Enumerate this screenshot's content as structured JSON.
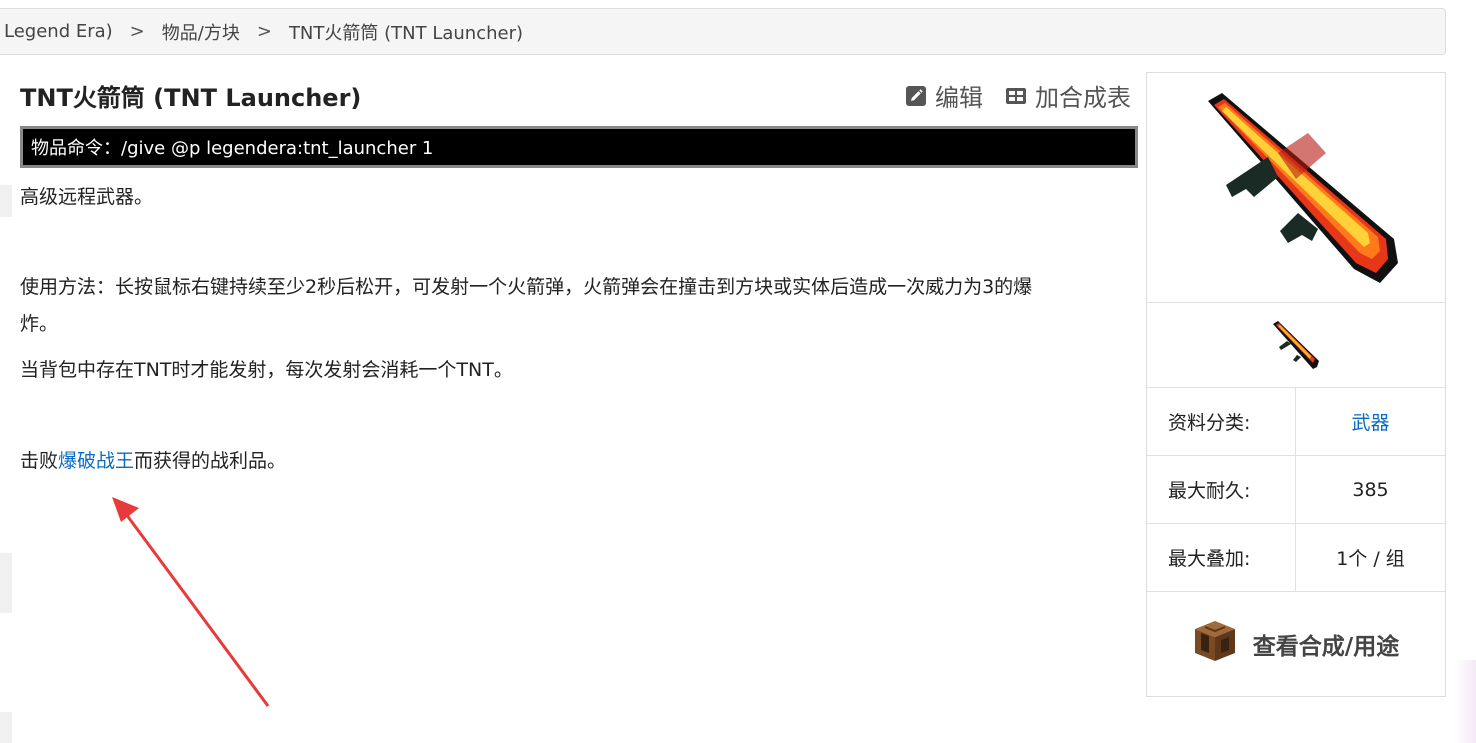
{
  "breadcrumb": {
    "items": [
      "Legend Era)",
      "物品/方块",
      "TNT火箭筒 (TNT Launcher)"
    ],
    "separator": ">"
  },
  "page": {
    "title": "TNT火箭筒 (TNT Launcher)",
    "edit_label": "编辑",
    "add_recipe_label": "加合成表",
    "command": "物品命令：/give @p legendera:tnt_launcher 1",
    "desc1": "高级远程武器。",
    "usage_line1": "使用方法：长按鼠标右键持续至少2秒后松开，可发射一个火箭弹，火箭弹会在撞击到方块或实体后造成一次威力为3的爆",
    "usage_line2": "炸。",
    "usage_line3": "当背包中存在TNT时才能发射，每次发射会消耗一个TNT。",
    "drop_prefix": "击败",
    "drop_link": "爆破战王",
    "drop_suffix": "而获得的战利品。"
  },
  "infobox": {
    "rows": [
      {
        "key": "资料分类:",
        "value": "武器"
      },
      {
        "key": "最大耐久:",
        "value": "385"
      },
      {
        "key": "最大叠加:",
        "value": "1个 / 组"
      }
    ],
    "view_recipe_label": "查看合成/用途"
  },
  "colors": {
    "link": "#0b6bc2",
    "command_bg": "#000000",
    "arrow": "#e83a3a"
  },
  "icons": [
    "edit-icon",
    "table-icon",
    "tnt-launcher-image",
    "tnt-launcher-thumbnail",
    "crafting-table-icon"
  ]
}
